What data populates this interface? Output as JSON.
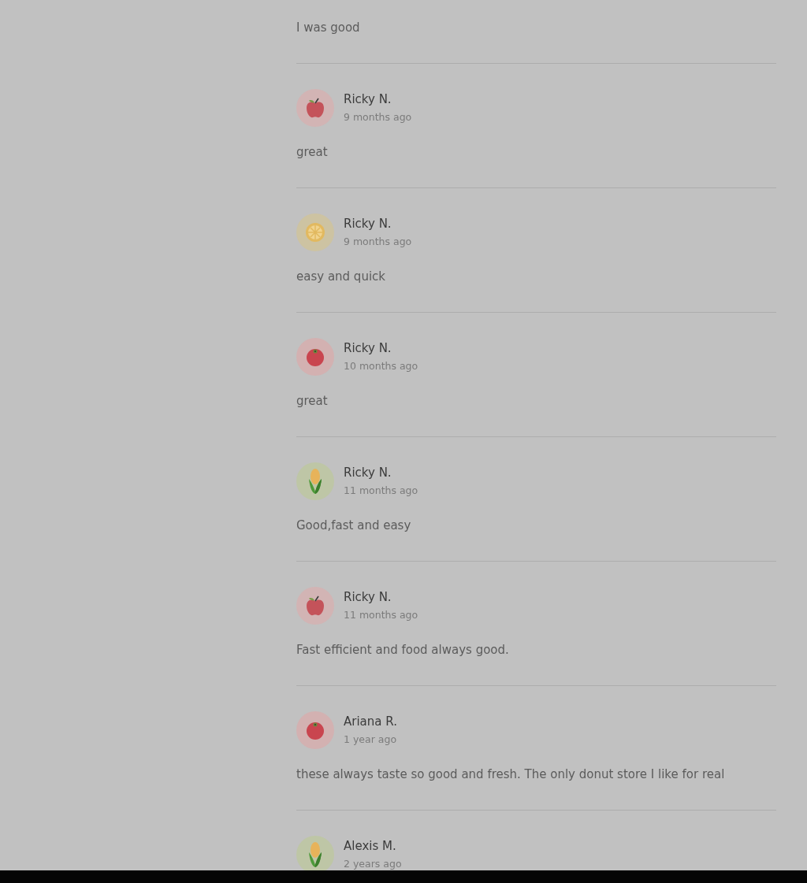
{
  "partial_review": {
    "text": "I was good"
  },
  "reviews": [
    {
      "name": "Ricky N.",
      "date": "9 months ago",
      "kind": "apple",
      "text": "great"
    },
    {
      "name": "Ricky N.",
      "date": "9 months ago",
      "kind": "lemon",
      "text": "easy and quick"
    },
    {
      "name": "Ricky N.",
      "date": "10 months ago",
      "kind": "tomato",
      "text": "great"
    },
    {
      "name": "Ricky N.",
      "date": "11 months ago",
      "kind": "corn",
      "text": "Good,fast and easy"
    },
    {
      "name": "Ricky N.",
      "date": "11 months ago",
      "kind": "apple",
      "text": "Fast efficient and food always good."
    },
    {
      "name": "Ariana R.",
      "date": "1 year ago",
      "kind": "tomato",
      "text": "these always taste so good and fresh. The only donut store I like for real"
    },
    {
      "name": "Alexis M.",
      "date": "2 years ago",
      "kind": "corn"
    }
  ]
}
